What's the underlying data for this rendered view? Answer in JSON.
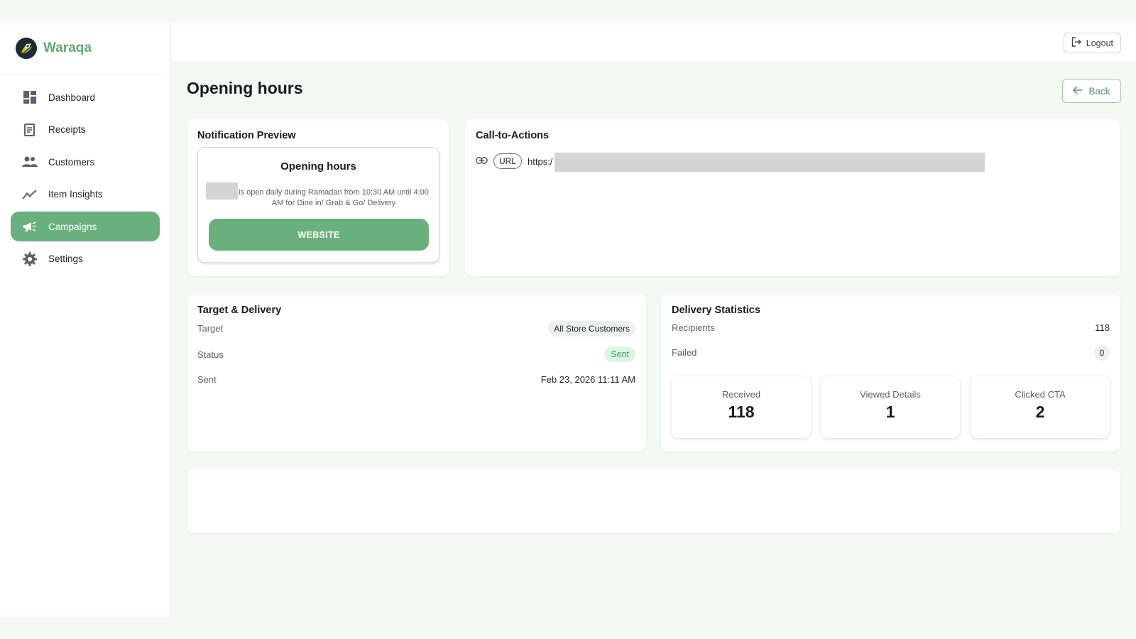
{
  "app": {
    "name": "Waraqa"
  },
  "sidebar": {
    "items": [
      {
        "label": "Dashboard",
        "icon": "dashboard-icon"
      },
      {
        "label": "Receipts",
        "icon": "receipt-icon"
      },
      {
        "label": "Customers",
        "icon": "people-icon"
      },
      {
        "label": "Item Insights",
        "icon": "trending-icon"
      },
      {
        "label": "Campaigns",
        "icon": "megaphone-icon",
        "active": true
      },
      {
        "label": "Settings",
        "icon": "gear-icon"
      }
    ]
  },
  "header": {
    "logout_label": "Logout"
  },
  "page": {
    "title": "Opening hours",
    "back_label": "Back"
  },
  "notification_preview": {
    "card_title": "Notification Preview",
    "title": "Opening hours",
    "body": "is open daily during Ramadan from 10:30 AM until 4:00 AM for Dine in/ Grab & Go/ Delivery",
    "button_label": "WEBSITE"
  },
  "cta": {
    "card_title": "Call-to-Actions",
    "type_label": "URL",
    "url_prefix": "https:/"
  },
  "target_delivery": {
    "card_title": "Target & Delivery",
    "target_label": "Target",
    "target_value": "All Store Customers",
    "status_label": "Status",
    "status_value": "Sent",
    "sent_label": "Sent",
    "sent_value": "Feb 23, 2026 11:11 AM"
  },
  "delivery_stats": {
    "card_title": "Delivery Statistics",
    "recipients_label": "Recipients",
    "recipients_value": "118",
    "failed_label": "Failed",
    "failed_value": "0",
    "tiles": [
      {
        "label": "Received",
        "value": "118"
      },
      {
        "label": "Viewed Details",
        "value": "1"
      },
      {
        "label": "Clicked CTA",
        "value": "2"
      }
    ]
  },
  "colors": {
    "accent": "#6ab07e",
    "brand_text": "#5fa972",
    "success_bg": "#ddf6e4"
  }
}
